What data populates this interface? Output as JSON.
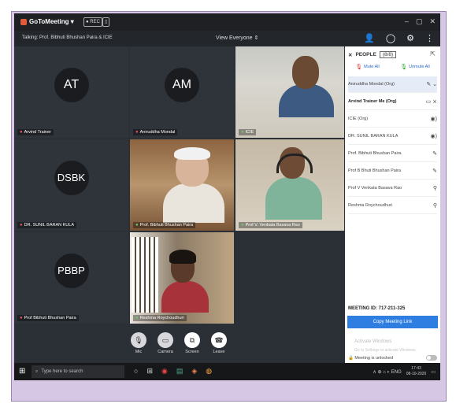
{
  "window": {
    "app_name": "GoToMeeting ▾",
    "chip1": "● REC",
    "chip2": "▯",
    "controls": [
      "–",
      "▢",
      "✕"
    ]
  },
  "infobar": {
    "talking": "Talking: Prof. Bibhuti Bhushan Paira & ICIE",
    "view": "View Everyone ⇕",
    "icons": [
      "person-add-icon",
      "chat-icon",
      "settings-icon",
      "more-icon"
    ]
  },
  "tiles": [
    {
      "initials": "AT",
      "name": "Arvind Trainer",
      "mic": "red",
      "cam": "none"
    },
    {
      "initials": "AM",
      "name": "Aniruddha Mondal",
      "mic": "red",
      "cam": "none"
    },
    {
      "initials": "",
      "name": "ICIE",
      "mic": "green",
      "cam": "cam1"
    },
    {
      "initials": "DSBK",
      "name": "DR. SUNIL BARAN KULA",
      "mic": "red",
      "cam": "none"
    },
    {
      "initials": "",
      "name": "Prof. Bibhuti Bhushan Paira",
      "mic": "green",
      "cam": "cam2"
    },
    {
      "initials": "",
      "name": "Prof V. Venkata Basava Rao",
      "mic": "green",
      "cam": "cam3"
    },
    {
      "initials": "PBBP",
      "name": "Prof Bibhuti Bhushan Paira",
      "mic": "red",
      "cam": "none"
    },
    {
      "initials": "",
      "name": "Reshma Roychoudhuri",
      "mic": "green",
      "cam": "cam4"
    }
  ],
  "meeting_toolbar": [
    {
      "label": "Mic",
      "icon": "mic-icon"
    },
    {
      "label": "Camera",
      "icon": "camera-icon"
    },
    {
      "label": "Screen",
      "icon": "screen-share-icon"
    },
    {
      "label": "Leave",
      "icon": "leave-icon"
    }
  ],
  "people_panel": {
    "title": "PEOPLE",
    "count": "(8/8)",
    "mute_all": "Mute All",
    "unmute_all": "Unmute All",
    "rows": [
      {
        "name": "Aniruddha Mondal (Org)",
        "status": "✎ ⌄",
        "highlight": true,
        "bold": false
      },
      {
        "name": "Arvind Trainer   Me (Org)",
        "status": "▭ ⨯",
        "highlight": false,
        "bold": true
      },
      {
        "name": "ICIE (Org)",
        "status": "◉)",
        "highlight": false,
        "bold": false
      },
      {
        "name": "DR. SUNIL BARAN KULA",
        "status": "◉)",
        "highlight": false,
        "bold": false
      },
      {
        "name": "Prof. Bibhuti Bhushan Paira",
        "status": "✎",
        "highlight": false,
        "bold": false
      },
      {
        "name": "Prof B Bhuti Bhushan Paira",
        "status": "✎",
        "highlight": false,
        "bold": false
      },
      {
        "name": "Prof V Venkata Basava Rao",
        "status": "⚲",
        "highlight": false,
        "bold": false
      },
      {
        "name": "Reshma Roychoudhuri",
        "status": "⚲",
        "highlight": false,
        "bold": false
      }
    ],
    "meeting_id_label": "MEETING ID:",
    "meeting_id_value": "717-211-325",
    "copy_button": "Copy Meeting Link",
    "activate_1": "Activate Windows",
    "activate_2": "Go to Settings to activate Windows.",
    "unlock_label": "Meeting is unlocked"
  },
  "taskbar": {
    "search_placeholder": "Type here to search",
    "apps": [
      "○",
      "⊞",
      "◉",
      "▤",
      "◈",
      "◍"
    ],
    "tray": "∧ ⊕ ⌂ ◐ ENG",
    "time": "17:43",
    "date": "08-10-2020"
  }
}
